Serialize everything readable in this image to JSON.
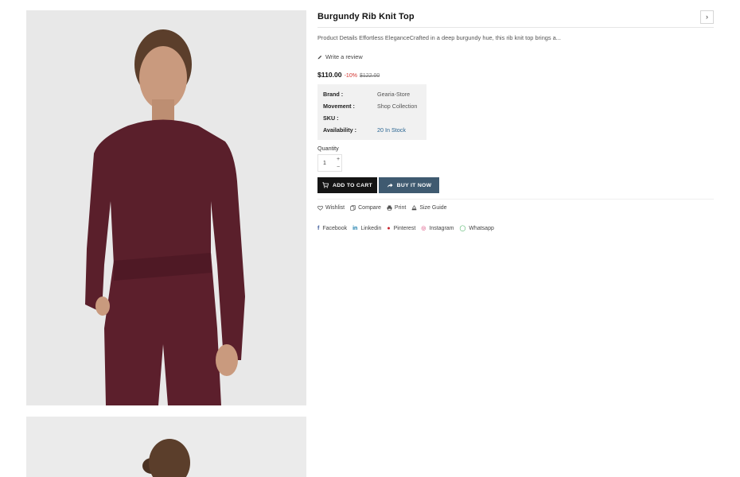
{
  "product": {
    "title": "Burgundy Rib Knit Top",
    "description": "Product Details Effortless EleganceCrafted in a deep burgundy hue, this rib knit top brings a...",
    "review_link": "Write a review",
    "price": "$110.00",
    "discount": "-10%",
    "compare_price": "$122.00"
  },
  "meta": {
    "brand_label": "Brand :",
    "brand_value": "Gearia-Store",
    "movement_label": "Movement :",
    "movement_value": "Shop Collection",
    "sku_label": "SKU :",
    "sku_value": "",
    "availability_label": "Availability :",
    "availability_value": "20 In Stock"
  },
  "quantity": {
    "label": "Quantity",
    "value": "1",
    "plus": "+",
    "minus": "−"
  },
  "buttons": {
    "add_to_cart": "ADD TO CART",
    "buy_now": "BUY IT NOW"
  },
  "tools": {
    "wishlist": "Wishlist",
    "compare": "Compare",
    "print": "Print",
    "size_guide": "Size Guide"
  },
  "share": {
    "facebook": "Facebook",
    "linkedin": "Linkedin",
    "pinterest": "Pinterest",
    "instagram": "Instagram",
    "whatsapp": "Whatsapp"
  },
  "icons": {
    "next": "chevron-right-icon",
    "review": "pencil-icon",
    "cart": "cart-icon",
    "buy": "share-arrow-icon",
    "wishlist": "heart-icon",
    "compare": "compare-icon",
    "print": "printer-icon",
    "size_guide": "ruler-icon",
    "facebook": "facebook-icon",
    "linkedin": "linkedin-icon",
    "pinterest": "pinterest-icon",
    "instagram": "instagram-icon",
    "whatsapp": "whatsapp-icon"
  },
  "colors": {
    "buy_button": "#3f5a70",
    "cart_button": "#141414",
    "discount": "#d2322d",
    "stock": "#2a6592",
    "garment": "#5a1f2b"
  }
}
